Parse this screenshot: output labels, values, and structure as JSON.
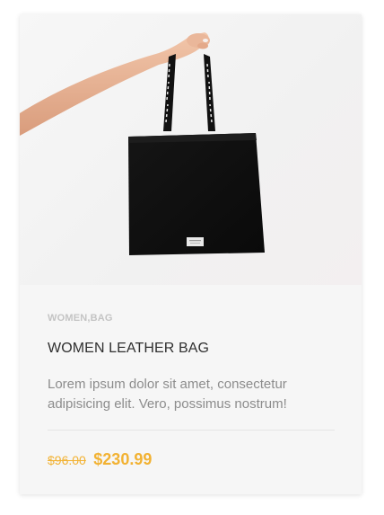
{
  "product": {
    "category": "WOMEN,BAG",
    "title": "WOMEN LEATHER BAG",
    "description": "Lorem ipsum dolor sit amet, consectetur adipisicing elit. Vero, possimus nostrum!",
    "old_price": "$96.00",
    "new_price": "$230.99",
    "image": "hand-holding-black-tote-bag-image"
  },
  "colors": {
    "price": "#f2b233",
    "category": "#c4c4c4",
    "title": "#2f2f2f",
    "description": "#8c8c8c",
    "card_background": "#f6f6f6"
  }
}
